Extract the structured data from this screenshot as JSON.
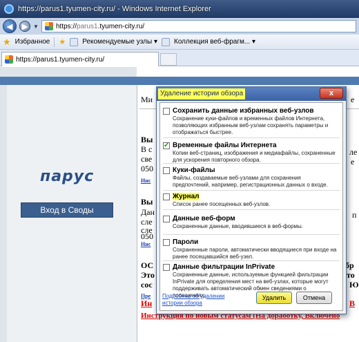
{
  "window": {
    "title": "https://parus1.tyumen-city.ru/ - Windows Internet Explorer"
  },
  "address_bar": {
    "url_prefix": "https://",
    "url_gray": "parus1",
    "url_rest": ".tyumen-city.ru/"
  },
  "favorites_bar": {
    "favorites_label": "Избранное",
    "suggested_sites": "Рекомендуемые узлы ▾",
    "web_slice_gallery": "Коллекция веб-фрагм... ▾"
  },
  "tab": {
    "label": "https://parus1.tyumen-city.ru/"
  },
  "page": {
    "logo": "парус",
    "login_button": "Вход в Своды",
    "fragments": {
      "f1": "Ми",
      "f2": "Вы",
      "f3": "В с",
      "f4": "све",
      "f5": "050",
      "f6": "Инс",
      "f7": "Вы",
      "f8": "Дан",
      "f9": "сле",
      "f10": "сле",
      "f11": "050",
      "f12": "Инс",
      "f13": "ОС",
      "f14": "Это",
      "f15": "сос",
      "f16": "Пре",
      "f17": "Ин",
      "f18": "Инструкция по новым статусам (На доработку, Включено",
      "r1": "е",
      "r2": "ле",
      "r3": "е",
      "r4": "п",
      "r5": "бр",
      "r6": "то",
      "r7": "Ю",
      "r8": "В"
    }
  },
  "dialog": {
    "title": "Удаление истории обзора",
    "close_symbol": "x",
    "options": [
      {
        "label": "Сохранить данные избранных веб-узлов",
        "desc": "Сохранение куки-файлов и временных файлов Интернета, позволяющих избранным веб-узлам сохранять параметры и отображаться быстрее.",
        "checked": false
      },
      {
        "label": "Временные файлы Интернета",
        "desc": "Копии веб-страниц, изображения и медиафайлы, сохраненные для ускорения повторного обзора.",
        "checked": true
      },
      {
        "label": "Куки-файлы",
        "desc": "Файлы, создаваемые веб-узлами для сохранения предпочтений, например, регистрационных данных о входе.",
        "checked": false
      },
      {
        "label": "Журнал",
        "desc": "Список ранее посещенных веб-узлов.",
        "checked": false
      },
      {
        "label": "Данные веб-форм",
        "desc": "Сохраненные данные, вводившиеся в веб-формы.",
        "checked": false
      },
      {
        "label": "Пароли",
        "desc": "Сохраненные пароли, автоматически вводящиеся при входе на ранее посещавшийся веб-узел.",
        "checked": false
      },
      {
        "label": "Данные фильтрации InPrivate",
        "desc": "Сохраненные данные, используемые функцией фильтрации InPrivate для определения мест на веб-узлах, которые могут поддерживать автоматический обмен сведениями о посещениях.",
        "checked": false
      }
    ],
    "check_mark": "✓",
    "more_link": "Подробнее об удалении истории обзора",
    "delete_button": "Удалить",
    "cancel_button": "Отмена"
  }
}
